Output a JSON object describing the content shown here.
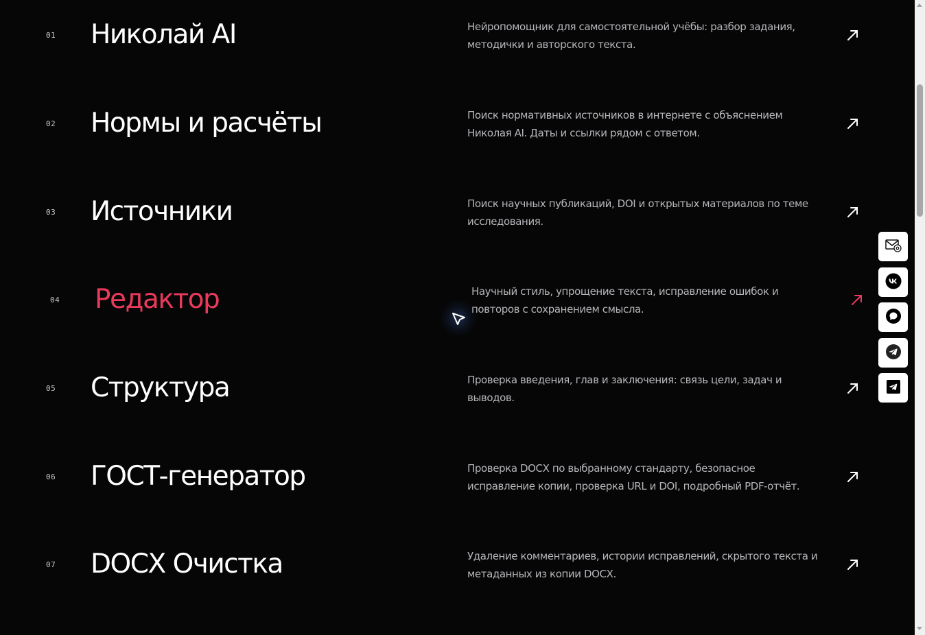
{
  "colors": {
    "background": "#060607",
    "text": "#ffffff",
    "muted": "#b7b7bb",
    "accent": "#ea3a5b"
  },
  "services": [
    {
      "num": "01",
      "title": "Николай AI",
      "desc": "Нейропомощник для самостоятельной учёбы: разбор задания, методички и авторского текста."
    },
    {
      "num": "02",
      "title": "Нормы и расчёты",
      "desc": "Поиск нормативных источников в интернете с объяснением Николая AI. Даты и ссылки рядом с ответом."
    },
    {
      "num": "03",
      "title": "Источники",
      "desc": "Поиск научных публикаций, DOI и открытых материалов по теме исследования."
    },
    {
      "num": "04",
      "title": "Редактор",
      "desc": "Научный стиль, упрощение текста, исправление ошибок и повторов с сохранением смысла.",
      "active": true
    },
    {
      "num": "05",
      "title": "Структура",
      "desc": "Проверка введения, глав и заключения: связь цели, задач и выводов."
    },
    {
      "num": "06",
      "title": "ГОСТ-генератор",
      "desc": "Проверка DOCX по выбранному стандарту, безопасное исправление копии, проверка URL и DOI, подробный PDF-отчёт."
    },
    {
      "num": "07",
      "title": "DOCX Очистка",
      "desc": "Удаление комментариев, истории исправлений, скрытого текста и метаданных из копии DOCX."
    }
  ],
  "social": [
    {
      "name": "email",
      "icon": "mail-at-icon"
    },
    {
      "name": "vk",
      "icon": "vk-icon"
    },
    {
      "name": "chat",
      "icon": "chat-bubble-icon"
    },
    {
      "name": "telegram",
      "icon": "telegram-icon"
    },
    {
      "name": "telegram-channel",
      "icon": "telegram-square-icon"
    }
  ]
}
